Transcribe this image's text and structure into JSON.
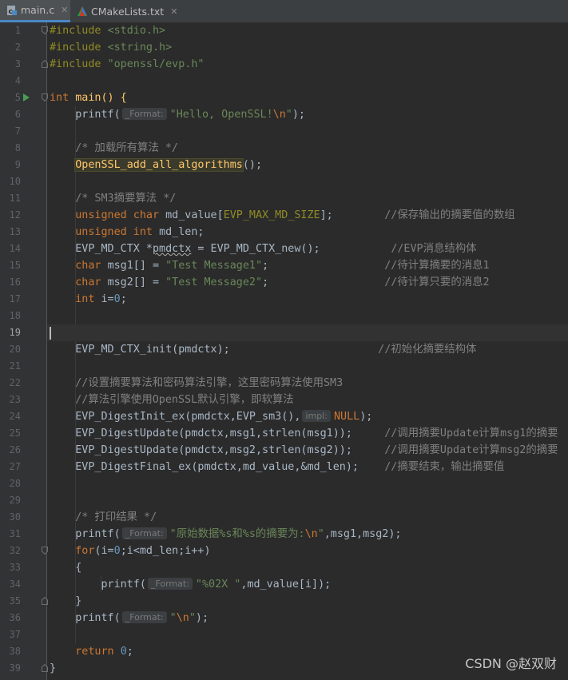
{
  "tabs": [
    {
      "label": "main.c",
      "icon": "c-file-icon",
      "active": true
    },
    {
      "label": "CMakeLists.txt",
      "icon": "cmake-icon",
      "active": false
    }
  ],
  "line_numbers": [
    "1",
    "2",
    "3",
    "4",
    "5",
    "6",
    "7",
    "8",
    "9",
    "10",
    "11",
    "12",
    "13",
    "14",
    "15",
    "16",
    "17",
    "18",
    "19",
    "20",
    "21",
    "22",
    "23",
    "24",
    "25",
    "26",
    "27",
    "28",
    "29",
    "30",
    "31",
    "32",
    "33",
    "34",
    "35",
    "36",
    "37",
    "38",
    "39"
  ],
  "hints": {
    "format": "_Format:",
    "impl": "impl:"
  },
  "code": {
    "l1_kw": "#include",
    "l1_arg": "<stdio.h>",
    "l2_kw": "#include",
    "l2_arg": "<string.h>",
    "l3_kw": "#include",
    "l3_arg": "\"openssl/evp.h\"",
    "l5_kw": "int",
    "l5_rest": "main() {",
    "l6_fn": "printf(",
    "l6_str": "\"Hello, OpenSSL!",
    "l6_esc": "\\n",
    "l6_end": "\");",
    "l8": "/* 加载所有算法 */",
    "l9_fn": "OpenSSL_add_all_algorithms",
    "l9_end": "();",
    "l11": "/* SM3摘要算法 */",
    "l12_kw": "unsigned char",
    "l12_mid": "md_value[",
    "l12_macro": "EVP_MAX_MD_SIZE",
    "l12_end": "];",
    "l12_cmt": "//保存输出的摘要值的数组",
    "l13_kw": "unsigned int",
    "l13_rest": "md_len;",
    "l14_a": "EVP_MD_CTX *",
    "l14_var": "pmdctx",
    "l14_b": " = EVP_MD_CTX_new();",
    "l14_cmt": "//EVP消息结构体",
    "l15_kw": "char",
    "l15_mid": "msg1[] = ",
    "l15_str": "\"Test Message1\"",
    "l15_end": ";",
    "l15_cmt": "//待计算摘要的消息1",
    "l16_kw": "char",
    "l16_mid": "msg2[] = ",
    "l16_str": "\"Test Message2\"",
    "l16_end": ";",
    "l16_cmt": "//待计算只要的消息2",
    "l17_kw": "int",
    "l17_mid": "i=",
    "l17_num": "0",
    "l17_end": ";",
    "l20": "EVP_MD_CTX_init(pmdctx);",
    "l20_cmt": "//初始化摘要结构体",
    "l22": "//设置摘要算法和密码算法引擎，这里密码算法使用SM3",
    "l23": "//算法引擎使用OpenSSL默认引擎，即软算法",
    "l24_a": "EVP_DigestInit_ex(pmdctx,EVP_sm3(),",
    "l24_kw": "NULL",
    "l24_end": ");",
    "l25": "EVP_DigestUpdate(pmdctx,msg1,strlen(msg1));",
    "l25_cmt": "//调用摘要Update计算msg1的摘要",
    "l26": "EVP_DigestUpdate(pmdctx,msg2,strlen(msg2));",
    "l26_cmt": "//调用摘要Update计算msg2的摘要",
    "l27": "EVP_DigestFinal_ex(pmdctx,md_value,&md_len);",
    "l27_cmt": "//摘要结束，输出摘要值",
    "l30": "/* 打印结果 */",
    "l31_fn": "printf(",
    "l31_str": "\"原始数据%s和%s的摘要为:",
    "l31_esc": "\\n",
    "l31_end": "\",msg1,msg2);",
    "l32_kw": "for",
    "l32_a": "(i=",
    "l32_num": "0",
    "l32_b": ";i<md_len;i++)",
    "l33": "{",
    "l34_fn": "printf(",
    "l34_str": "\"%02X \"",
    "l34_end": ",md_value[i]);",
    "l35": "}",
    "l36_fn": "printf(",
    "l36_str": "\"",
    "l36_esc": "\\n",
    "l36_end": "\");",
    "l38_kw": "return",
    "l38_num": "0",
    "l38_end": ";",
    "l39": "}"
  },
  "watermark": "CSDN @赵双财",
  "colors": {
    "background": "#2b2b2b",
    "keyword": "#cc7832",
    "string": "#6a8759",
    "comment": "#808080",
    "number": "#6897bb",
    "function": "#ffc66d",
    "macro": "#908b25"
  }
}
